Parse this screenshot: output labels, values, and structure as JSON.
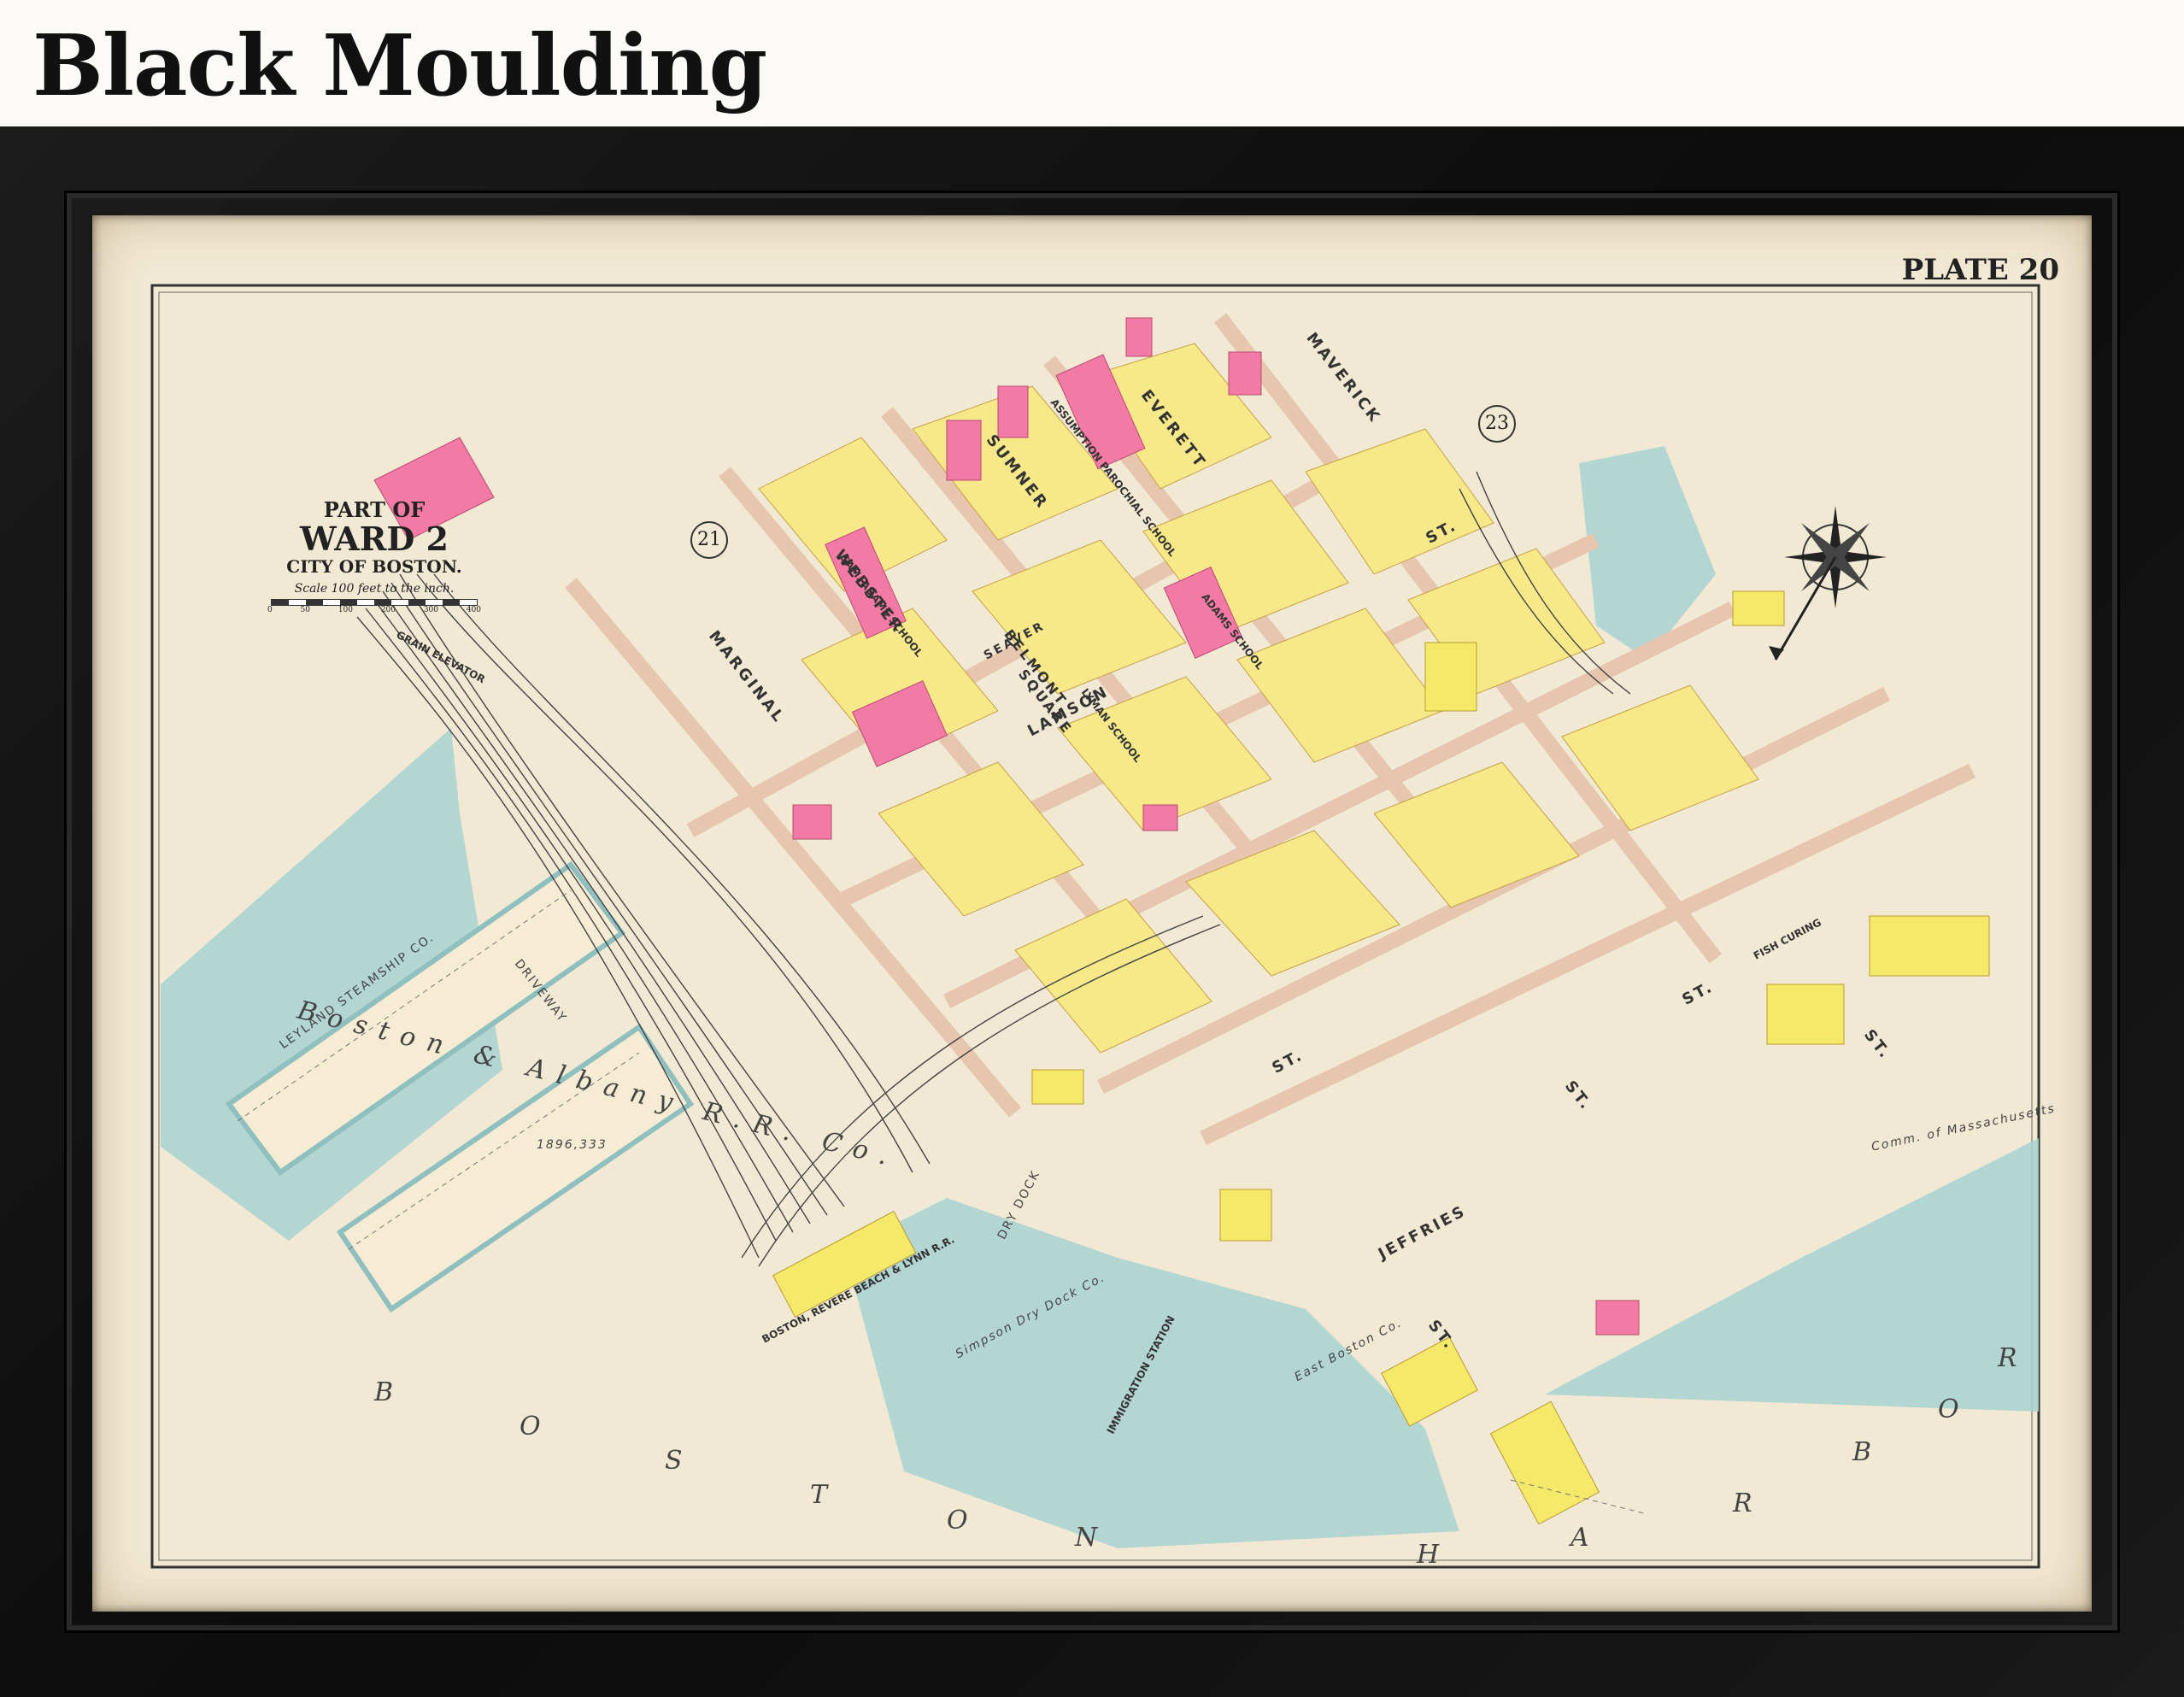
{
  "heading": "Black Moulding",
  "map": {
    "plate": "PLATE 20",
    "title": {
      "line1": "PART OF",
      "line2": "WARD 2",
      "line3": "CITY OF BOSTON.",
      "scale": "Scale 100 feet to the inch.",
      "scale_ticks": [
        "0",
        "50",
        "100",
        "200",
        "300",
        "400"
      ]
    },
    "ward_numbers": [
      "21",
      "23"
    ],
    "harbor_letters": [
      "B",
      "O",
      "S",
      "T",
      "O",
      "N",
      "H",
      "A",
      "R",
      "B",
      "O",
      "R"
    ],
    "streets": {
      "marginal": "MARGINAL",
      "webster": "WEBSTER",
      "sumner": "SUMNER",
      "everett": "EVERETT",
      "maverick": "MAVERICK",
      "lamson": "LAMSON",
      "seaver": "SEAVER",
      "jeffries": "JEFFRIES",
      "st1": "ST.",
      "st2": "ST.",
      "st3": "ST.",
      "st4": "ST.",
      "st5": "ST.",
      "st6": "ST.",
      "belmont": "BELMONT",
      "square": "SQUARE",
      "driveway": "DRIVEWAY"
    },
    "railroad": "Boston & Albany R.R. Co.",
    "railroad_area": "1896,333",
    "leyland": "LEYLAND STEAMSHIP CO.",
    "buildings": {
      "grain": "GRAIN ELEVATOR",
      "sam_adams": "SAM. ADAMS SCHOOL",
      "adams": "ADAMS SCHOOL",
      "lyman": "LYMAN SCHOOL",
      "assumption": "ASSUMPTION PAROCHIAL SCHOOL",
      "revere": "BOSTON, REVERE BEACH & LYNN R.R.",
      "immigration": "IMMIGRATION STATION",
      "simpson": "Simpson Dry Dock Co.",
      "east_boston": "East Boston Co.",
      "fish": "FISH CURING",
      "commonwealth": "Comm. of Massachusetts",
      "dry_dock": "DRY DOCK"
    },
    "colors": {
      "water": "#a8d2d2",
      "land": "#f6ecd4",
      "brick": "#f27aa4",
      "wood": "#f5e96a",
      "street": "#ecd2bc"
    }
  }
}
